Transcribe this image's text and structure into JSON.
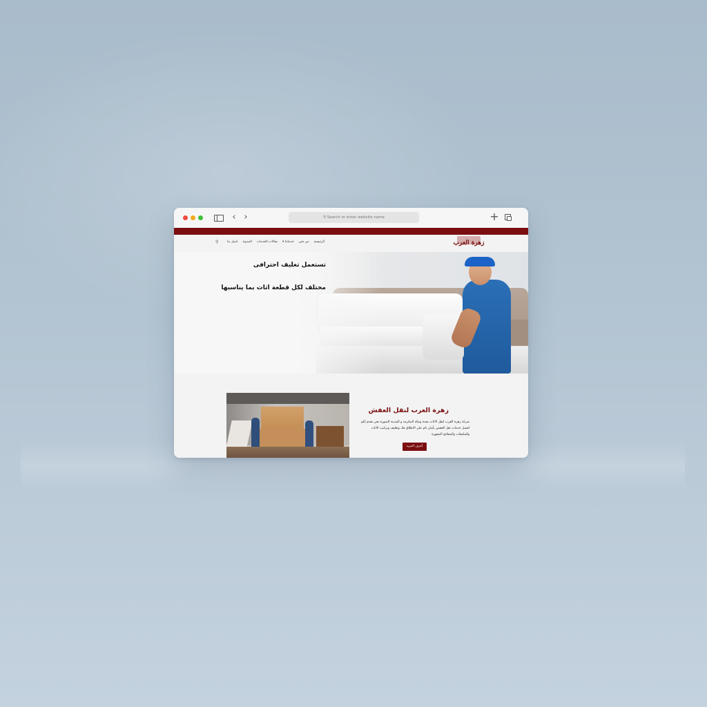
{
  "browser": {
    "url_placeholder": "Search or enter website name"
  },
  "site": {
    "logo_text": "زهرة العرب",
    "nav": [
      "الرئيسية",
      "من نحن",
      "خدماتنا ▾",
      "مقالات الخدمات",
      "المدونة",
      "اتصل بنا"
    ],
    "hero": {
      "line1": "تستعمل تغليف احترافى",
      "line2": "مختلف لكل قطعة اثاث بما يناسبها"
    },
    "about": {
      "title": "زهرة العرب لنقل العفش",
      "text": "شركة زهرة العرب لنقل الاثاث بجدة ومكة المكرمة و المدينة المنورة نحن نقدم لكم افضل خدمات نقل العفش بأمان تام على الاطلاق فك وتغليف وتركيب الاثاث والمكيفات والمطابخ المجهزة",
      "button": "أعرف المزيد"
    }
  },
  "colors": {
    "brand": "#7a0e10"
  }
}
